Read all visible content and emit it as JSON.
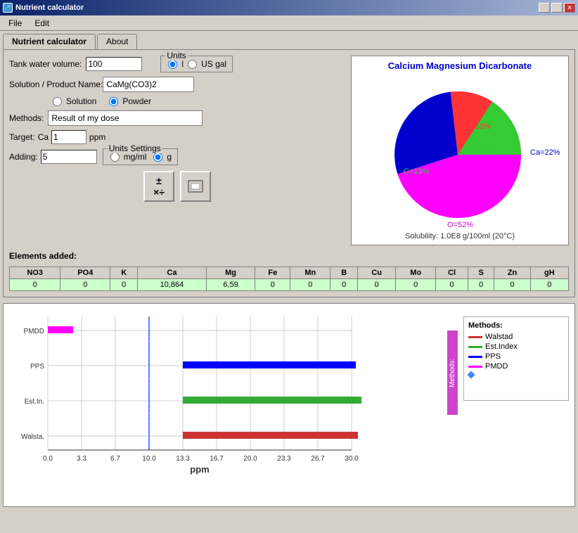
{
  "window": {
    "title": "Nutrient calculator",
    "icon": "🧪"
  },
  "menu": {
    "file": "File",
    "edit": "Edit"
  },
  "tabs": [
    {
      "id": "nutrient",
      "label": "Nutrient calculator",
      "active": true
    },
    {
      "id": "about",
      "label": "About",
      "active": false
    }
  ],
  "form": {
    "tank_volume_label": "Tank water volume:",
    "tank_volume_value": "100",
    "units_legend": "Units",
    "units_l": "l",
    "units_usgal": "US gal",
    "solution_label": "Solution / Product Name:",
    "solution_value": "CaMg(CO3)2",
    "solution_radio": "Solution",
    "powder_radio": "Powder",
    "methods_label": "Methods:",
    "methods_value": "Result of my dose",
    "target_label": "Target:",
    "target_element": "Ca",
    "target_value": "1",
    "target_unit": "ppm",
    "adding_label": "Adding:",
    "adding_value": "5",
    "units_settings_legend": "Units Settings",
    "mgml_label": "mg/ml",
    "g_label": "g"
  },
  "pie": {
    "title": "Calcium Magnesium Dicarbonate",
    "segments": [
      {
        "label": "Ca=22%",
        "value": 22,
        "color": "#0000cc",
        "labelX": 260,
        "labelY": 115
      },
      {
        "label": "Mg=13%",
        "value": 13,
        "color": "#ff3333",
        "labelX": 155,
        "labelY": 90
      },
      {
        "label": "C=13%",
        "value": 13,
        "color": "#33cc33",
        "labelX": 100,
        "labelY": 145
      },
      {
        "label": "O=52%",
        "value": 52,
        "color": "#ff00ff",
        "labelX": 160,
        "labelY": 300
      }
    ],
    "solubility": "Solubility: 1.0E8 g/100ml (20°C)"
  },
  "elements_table": {
    "headers": [
      "NO3",
      "PO4",
      "K",
      "Ca",
      "Mg",
      "Fe",
      "Mn",
      "B",
      "Cu",
      "Mo",
      "Cl",
      "S",
      "Zn",
      "gH"
    ],
    "values": [
      "0",
      "0",
      "0",
      "10,864",
      "6,59",
      "0",
      "0",
      "0",
      "0",
      "0",
      "0",
      "0",
      "0",
      "0"
    ]
  },
  "elements_header": "Elements added:",
  "chart": {
    "methods_label": "Methods:",
    "x_axis_labels": [
      "0.0",
      "3.3",
      "6.7",
      "10.0",
      "13.3",
      "16.7",
      "20.0",
      "23.3",
      "26.7",
      "30.0"
    ],
    "x_label": "ppm",
    "vertical_line_pos": "10.0",
    "bars": [
      {
        "label": "PMDD",
        "color": "#ff00ff",
        "start_ppm": 0,
        "width_ppm": 2.5
      },
      {
        "label": "PPS",
        "color": "#0000ff",
        "start_ppm": 13.3,
        "width_ppm": 17.0
      },
      {
        "label": "Est.In.",
        "color": "#33aa33",
        "start_ppm": 13.3,
        "width_ppm": 17.5
      },
      {
        "label": "Walsta.",
        "color": "#cc3333",
        "start_ppm": 13.3,
        "width_ppm": 17.2
      }
    ],
    "legend": {
      "title": "Methods:",
      "items": [
        {
          "label": "Walstad",
          "color": "#cc3333",
          "type": "line"
        },
        {
          "label": "Est.Index",
          "color": "#33aa33",
          "type": "line"
        },
        {
          "label": "PPS",
          "color": "#0000ff",
          "type": "line"
        },
        {
          "label": "PMDD",
          "color": "#ff00ff",
          "type": "line"
        },
        {
          "label": "",
          "color": "#4488ff",
          "type": "diamond"
        }
      ]
    }
  },
  "buttons": {
    "calculate": "±×",
    "clear": ""
  }
}
